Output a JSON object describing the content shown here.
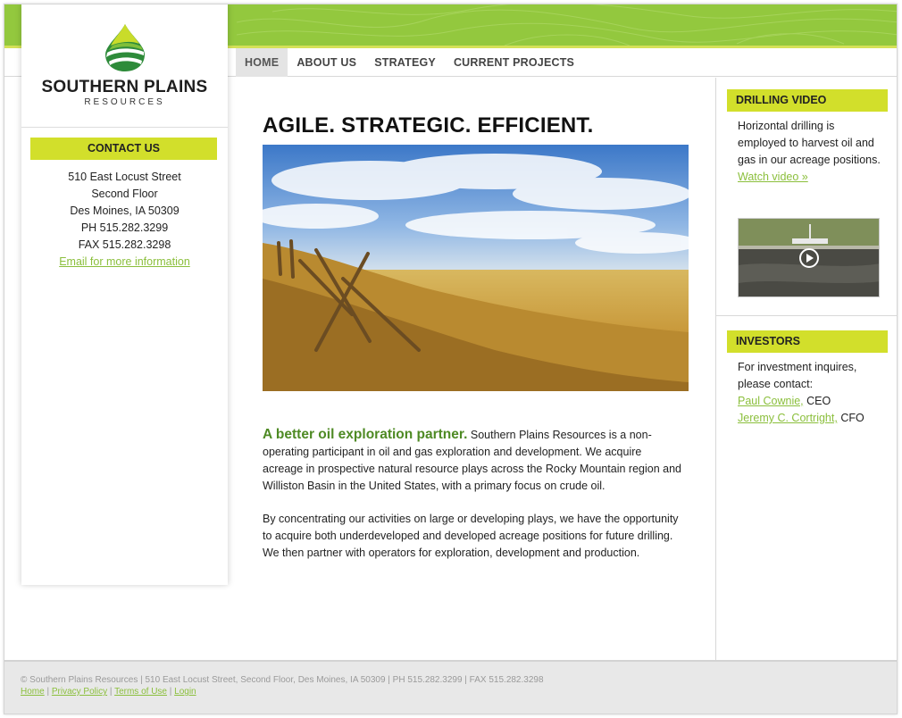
{
  "brand": {
    "name": "SOUTHERN PLAINS",
    "sub": "RESOURCES",
    "logo_icon": "oil-drop-logo-icon",
    "accent_color": "#d2df2b",
    "green": "#93c83e",
    "link_color": "#8bbf3c"
  },
  "nav": {
    "items": [
      {
        "label": "HOME",
        "active": true
      },
      {
        "label": "ABOUT US"
      },
      {
        "label": "STRATEGY"
      },
      {
        "label": "CURRENT PROJECTS"
      }
    ]
  },
  "sidebar": {
    "contact_heading": "CONTACT US",
    "lines": [
      "510 East Locust Street",
      "Second Floor",
      "Des Moines, IA 50309",
      "PH 515.282.3299",
      "FAX 515.282.3298"
    ],
    "email_link": "Email for more information"
  },
  "main": {
    "headline": "AGILE. STRATEGIC. EFFICIENT.",
    "lead": "A better oil exploration partner.",
    "para1": " Southern Plains Resources is a non-operating participant in oil and gas exploration and development. We acquire acreage in prospective natural resource plays across the Rocky Mountain region and Williston Basin in the United States, with a primary focus on crude oil.",
    "para2": "By concentrating our activities on large or developing plays, we have the opportunity to acquire both underdeveloped and developed acreage positions for future drilling. We then partner with operators for exploration, development and production."
  },
  "right": {
    "video_heading": "DRILLING VIDEO",
    "video_text": "Horizontal drilling is employed to harvest oil and gas in our acreage positions.",
    "video_link": "Watch video »",
    "investors_heading": "INVESTORS",
    "investors_text": "For investment inquires, please contact:",
    "contacts": [
      {
        "name": "Paul Cownie,",
        "role": " CEO"
      },
      {
        "name": "Jeremy C. Cortright,",
        "role": " CFO"
      }
    ]
  },
  "footer": {
    "line1": "© Southern Plains Resources | 510 East Locust Street, Second Floor, Des Moines, IA 50309 | PH 515.282.3299 | FAX 515.282.3298",
    "links": [
      "Home",
      "Privacy Policy",
      "Terms of Use",
      "Login"
    ]
  }
}
